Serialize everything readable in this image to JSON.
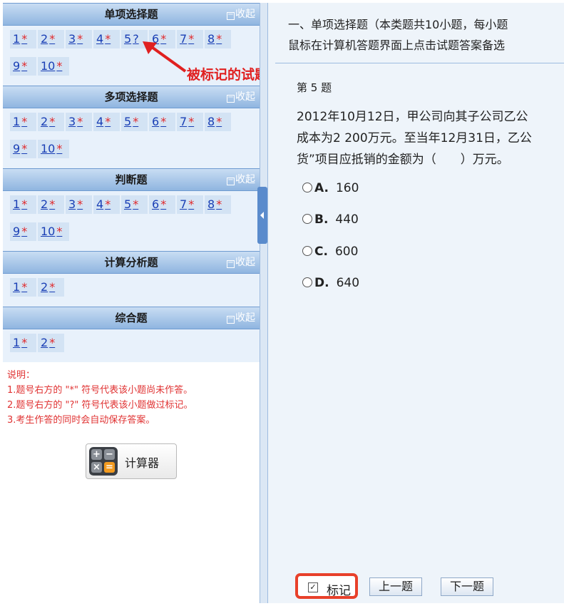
{
  "collapse_label": "收起",
  "sections": [
    {
      "title": "单项选择题",
      "questions": [
        {
          "n": "1",
          "m": "*"
        },
        {
          "n": "2",
          "m": "*"
        },
        {
          "n": "3",
          "m": "*"
        },
        {
          "n": "4",
          "m": "*"
        },
        {
          "n": "5",
          "m": "?"
        },
        {
          "n": "6",
          "m": "*"
        },
        {
          "n": "7",
          "m": "*"
        },
        {
          "n": "8",
          "m": "*"
        },
        {
          "n": "9",
          "m": "*"
        },
        {
          "n": "10",
          "m": "*"
        }
      ]
    },
    {
      "title": "多项选择题",
      "questions": [
        {
          "n": "1",
          "m": "*"
        },
        {
          "n": "2",
          "m": "*"
        },
        {
          "n": "3",
          "m": "*"
        },
        {
          "n": "4",
          "m": "*"
        },
        {
          "n": "5",
          "m": "*"
        },
        {
          "n": "6",
          "m": "*"
        },
        {
          "n": "7",
          "m": "*"
        },
        {
          "n": "8",
          "m": "*"
        },
        {
          "n": "9",
          "m": "*"
        },
        {
          "n": "10",
          "m": "*"
        }
      ]
    },
    {
      "title": "判断题",
      "questions": [
        {
          "n": "1",
          "m": "*"
        },
        {
          "n": "2",
          "m": "*"
        },
        {
          "n": "3",
          "m": "*"
        },
        {
          "n": "4",
          "m": "*"
        },
        {
          "n": "5",
          "m": "*"
        },
        {
          "n": "6",
          "m": "*"
        },
        {
          "n": "7",
          "m": "*"
        },
        {
          "n": "8",
          "m": "*"
        },
        {
          "n": "9",
          "m": "*"
        },
        {
          "n": "10",
          "m": "*"
        }
      ]
    },
    {
      "title": "计算分析题",
      "questions": [
        {
          "n": "1",
          "m": "*"
        },
        {
          "n": "2",
          "m": "*"
        }
      ]
    },
    {
      "title": "综合题",
      "questions": [
        {
          "n": "1",
          "m": "*"
        },
        {
          "n": "2",
          "m": "*"
        }
      ]
    }
  ],
  "annotation": "被标记的试题",
  "notes": {
    "title": "说明：",
    "lines": [
      "1.题号右方的 \"*\" 符号代表该小题尚未作答。",
      "2.题号右方的 \"?\" 符号代表该小题做过标记。",
      "3.考生作答的同时会自动保存答案。"
    ]
  },
  "calculator_label": "计算器",
  "intro": {
    "line1": "一、单项选择题（本类题共10小题，每小题",
    "line2": "鼠标在计算机答题界面上点击试题答案备选"
  },
  "question": {
    "number_label": "第 5 题",
    "line1": "2012年10月12日，甲公司向其子公司乙公",
    "line2": "成本为2 200万元。至当年12月31日，乙公",
    "line3": "货”项目应抵销的金额为（　　）万元。"
  },
  "options": [
    {
      "letter": "A.",
      "value": "160"
    },
    {
      "letter": "B.",
      "value": "440"
    },
    {
      "letter": "C.",
      "value": "600"
    },
    {
      "letter": "D.",
      "value": "640"
    }
  ],
  "buttons": {
    "mark": "标记",
    "prev": "上一题",
    "next": "下一题"
  },
  "colors": {
    "accent_red": "#e02020",
    "link_blue": "#1a3fb5",
    "header_blue": "#8fb5e0"
  }
}
